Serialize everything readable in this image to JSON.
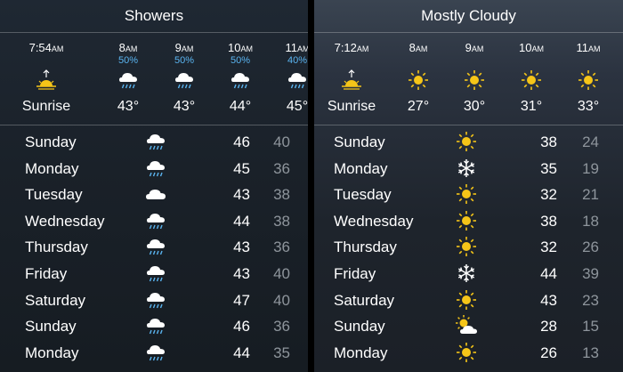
{
  "left": {
    "condition": "Showers",
    "hourly": [
      {
        "time": "7:54",
        "ampm": "AM",
        "pop": "",
        "icon": "sunrise-icon",
        "temp": "Sunrise"
      },
      {
        "time": "8",
        "ampm": "AM",
        "pop": "50%",
        "icon": "rain-icon",
        "temp": "43°"
      },
      {
        "time": "9",
        "ampm": "AM",
        "pop": "50%",
        "icon": "rain-icon",
        "temp": "43°"
      },
      {
        "time": "10",
        "ampm": "AM",
        "pop": "50%",
        "icon": "rain-icon",
        "temp": "44°"
      },
      {
        "time": "11",
        "ampm": "AM",
        "pop": "40%",
        "icon": "rain-icon",
        "temp": "45°"
      }
    ],
    "daily": [
      {
        "day": "Sunday",
        "icon": "rain-icon",
        "high": "46",
        "low": "40"
      },
      {
        "day": "Monday",
        "icon": "rain-icon",
        "high": "45",
        "low": "36"
      },
      {
        "day": "Tuesday",
        "icon": "cloud-icon",
        "high": "43",
        "low": "38"
      },
      {
        "day": "Wednesday",
        "icon": "rain-icon",
        "high": "44",
        "low": "38"
      },
      {
        "day": "Thursday",
        "icon": "rain-icon",
        "high": "43",
        "low": "36"
      },
      {
        "day": "Friday",
        "icon": "rain-icon",
        "high": "43",
        "low": "40"
      },
      {
        "day": "Saturday",
        "icon": "rain-icon",
        "high": "47",
        "low": "40"
      },
      {
        "day": "Sunday",
        "icon": "rain-icon",
        "high": "46",
        "low": "36"
      },
      {
        "day": "Monday",
        "icon": "rain-icon",
        "high": "44",
        "low": "35"
      }
    ]
  },
  "right": {
    "condition": "Mostly Cloudy",
    "hourly": [
      {
        "time": "7:12",
        "ampm": "AM",
        "pop": "",
        "icon": "sunrise-icon",
        "temp": "Sunrise"
      },
      {
        "time": "8",
        "ampm": "AM",
        "pop": "",
        "icon": "sun-icon",
        "temp": "27°"
      },
      {
        "time": "9",
        "ampm": "AM",
        "pop": "",
        "icon": "sun-icon",
        "temp": "30°"
      },
      {
        "time": "10",
        "ampm": "AM",
        "pop": "",
        "icon": "sun-icon",
        "temp": "31°"
      },
      {
        "time": "11",
        "ampm": "AM",
        "pop": "",
        "icon": "sun-icon",
        "temp": "33°"
      }
    ],
    "daily": [
      {
        "day": "Sunday",
        "icon": "sun-icon",
        "high": "38",
        "low": "24"
      },
      {
        "day": "Monday",
        "icon": "snowflake-icon",
        "high": "35",
        "low": "19"
      },
      {
        "day": "Tuesday",
        "icon": "sun-icon",
        "high": "32",
        "low": "21"
      },
      {
        "day": "Wednesday",
        "icon": "sun-icon",
        "high": "38",
        "low": "18"
      },
      {
        "day": "Thursday",
        "icon": "sun-icon",
        "high": "32",
        "low": "26"
      },
      {
        "day": "Friday",
        "icon": "snowflake-icon",
        "high": "44",
        "low": "39"
      },
      {
        "day": "Saturday",
        "icon": "sun-icon",
        "high": "43",
        "low": "23"
      },
      {
        "day": "Sunday",
        "icon": "partly-cloudy-icon",
        "high": "28",
        "low": "15"
      },
      {
        "day": "Monday",
        "icon": "sun-icon",
        "high": "26",
        "low": "13"
      }
    ]
  },
  "colors": {
    "precip": "#5ab4f0",
    "sun": "#f5c518",
    "low_temp": "#8e959c"
  }
}
